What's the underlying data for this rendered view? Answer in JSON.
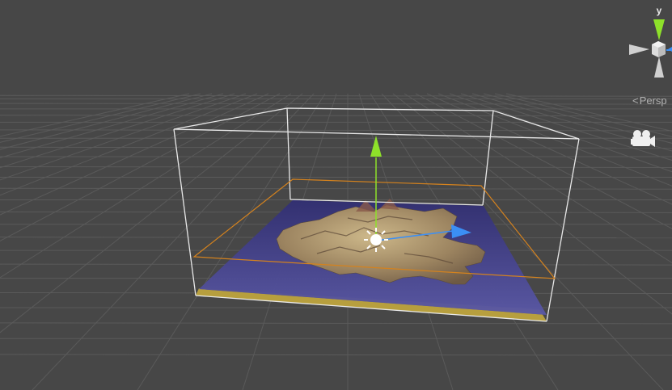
{
  "scene_view": {
    "background_color": "#474747",
    "grid_color": "#5e5e5e",
    "terrain_bounds_color": "#e8e8e8",
    "selection_outline_color": "#d4821e",
    "water_color": "#3b3a7a",
    "terrain_color": "#a8946a",
    "base_edge_color": "#c9b24a"
  },
  "scene_gizmo": {
    "axis_y_label": "y",
    "projection_label": "Persp",
    "y_axis_color": "#8ee12a",
    "z_axis_color": "#3b8ff5",
    "center_cube_icon": "cube-icon"
  },
  "transform_handle": {
    "y_arrow_color": "#8ee12a",
    "z_arrow_color": "#3b8ff5",
    "icon": "sun-icon"
  },
  "camera_icon": "camera-icon"
}
